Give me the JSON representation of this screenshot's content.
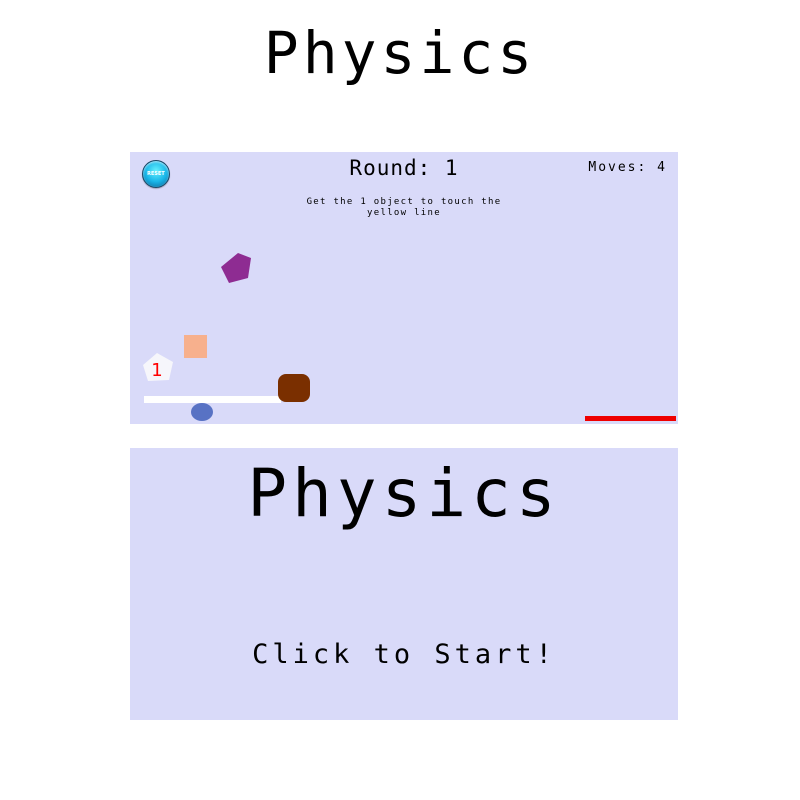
{
  "app": {
    "title": "Physics"
  },
  "game_panel": {
    "reset_button_label": "RESET",
    "round_text": "Round: 1",
    "moves_text": "Moves: 4",
    "instruction_text": "Get the 1 object to touch the yellow line",
    "objects": {
      "pentagon_label": "1",
      "colors": {
        "background": "#d9daf9",
        "purple_pentagon": "#8e2c92",
        "white_pentagon": "#f6f6fb",
        "orange_square": "#f7b08d",
        "brown_block": "#7a2f00",
        "blue_ball": "#5872c4",
        "platform": "#ffffff",
        "red_line": "#ef0000"
      }
    }
  },
  "start_screen": {
    "title": "Physics",
    "cta": "Click to Start!"
  }
}
